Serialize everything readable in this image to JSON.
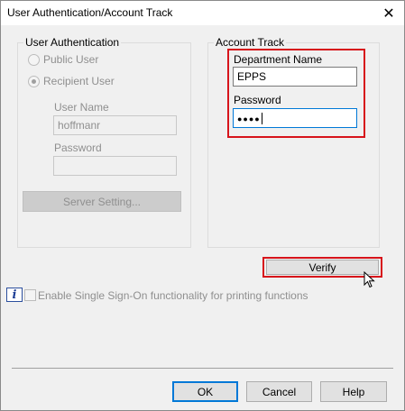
{
  "window": {
    "title": "User Authentication/Account Track"
  },
  "user_auth": {
    "legend": "User Authentication",
    "public_user_label": "Public User",
    "recipient_user_label": "Recipient User",
    "user_name_label": "User Name",
    "user_name_value": "hoffmanr",
    "password_label": "Password",
    "password_value": "",
    "server_setting_label": "Server Setting..."
  },
  "account_track": {
    "legend": "Account Track",
    "department_name_label": "Department Name",
    "department_name_value": "EPPS",
    "password_label": "Password",
    "password_masked": "●●●●"
  },
  "verify_label": "Verify",
  "sso": {
    "label": "Enable Single Sign-On functionality for printing functions"
  },
  "footer": {
    "ok_label": "OK",
    "cancel_label": "Cancel",
    "help_label": "Help"
  },
  "colors": {
    "highlight": "#d7141b",
    "focus": "#0078d7"
  },
  "icons": {
    "close": "close-icon",
    "info": "info-icon",
    "cursor": "mouse-pointer-icon"
  }
}
